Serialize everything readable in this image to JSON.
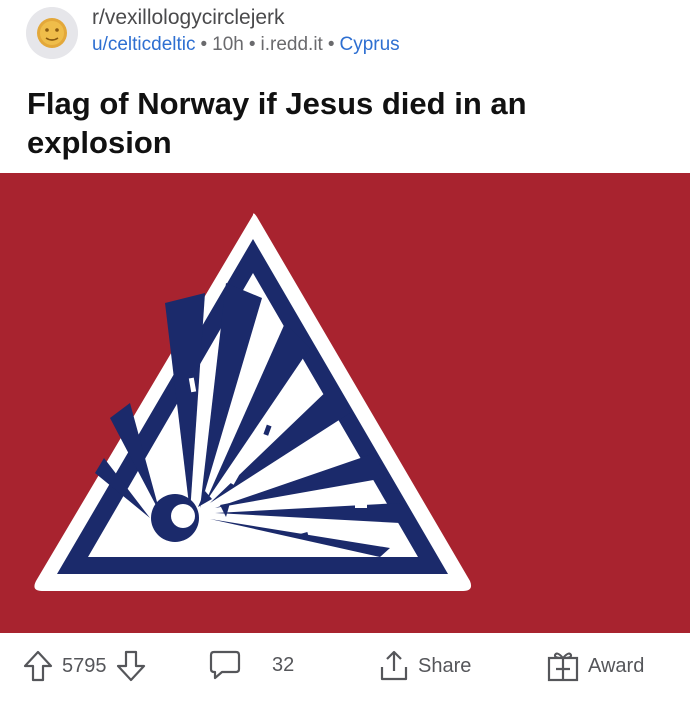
{
  "post": {
    "subreddit": "r/vexillologycirclejerk",
    "author": "u/celticdeltic",
    "age": "10h",
    "domain": "i.redd.it",
    "flair": "Cyprus",
    "title": "Flag of Norway if Jesus died in an explosion",
    "image": {
      "background_color": "#a8232f",
      "triangle_border_color": "#1b2a6b",
      "triangle_outline_color": "#ffffff",
      "symbol": "explosion-warning-triangle"
    }
  },
  "actions": {
    "upvote_count": "5795",
    "comment_count": "32",
    "share_label": "Share",
    "award_label": "Award"
  }
}
